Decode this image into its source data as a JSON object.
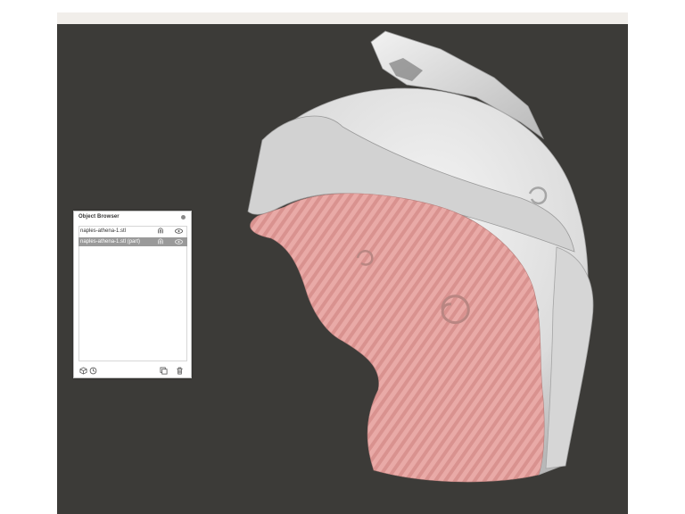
{
  "window": {
    "viewport_background": "#3c3b38",
    "topbar_color": "#f1eeea"
  },
  "model": {
    "name": "naples-athena-1.stl",
    "part_color": "#e9a9a6",
    "main_color": "#e4e4e4"
  },
  "object_browser": {
    "title": "Object Browser",
    "close_icon": "close-dot-icon",
    "items": [
      {
        "label": "naples-athena-1.stl",
        "selected": false,
        "icons": [
          "magnet-icon",
          "eye-icon"
        ]
      },
      {
        "label": "naples-athena-1.stl (part)",
        "selected": true,
        "icons": [
          "magnet-icon",
          "eye-icon"
        ]
      }
    ],
    "footer_icons": [
      "cube-icon",
      "clock-icon",
      "duplicate-icon",
      "trash-icon"
    ]
  }
}
